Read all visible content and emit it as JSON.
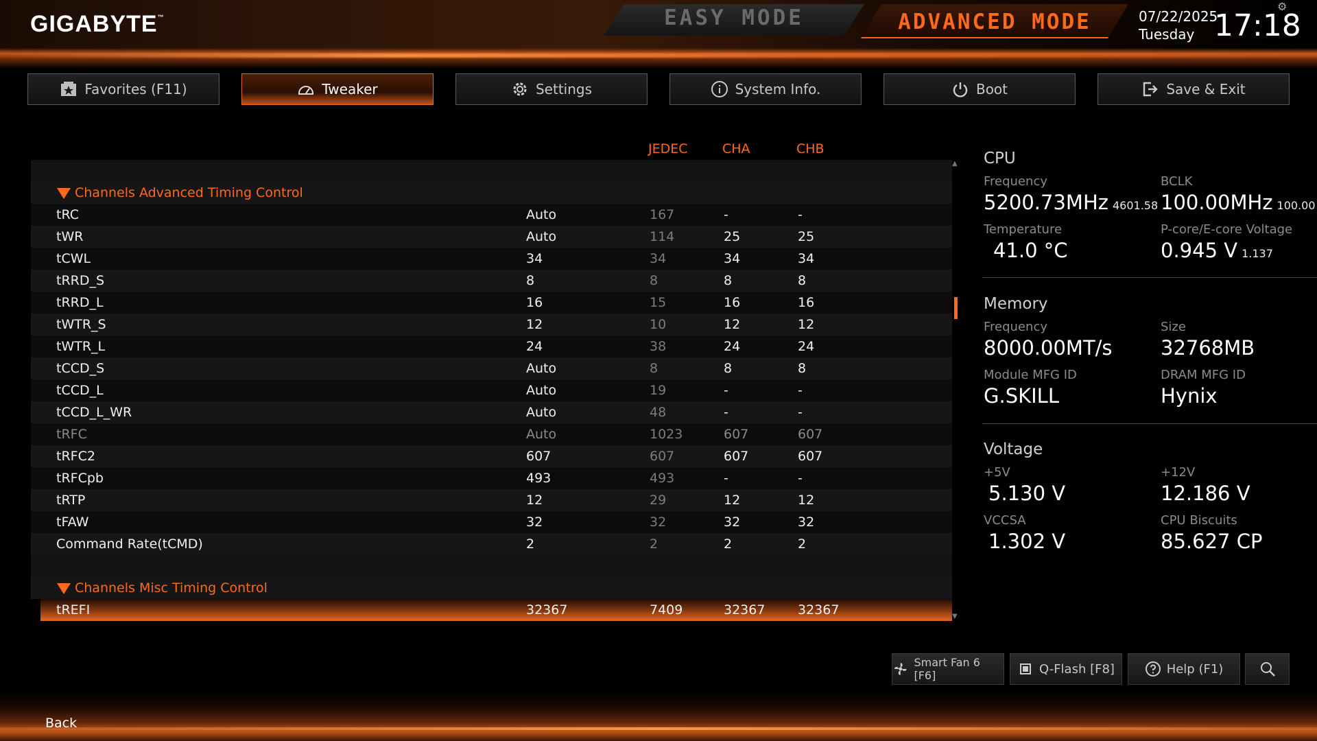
{
  "header": {
    "logo": "GIGABYTE",
    "logo_mark": "™",
    "easy_mode": "EASY MODE",
    "advanced_mode": "ADVANCED MODE",
    "date": "07/22/2025",
    "day": "Tuesday",
    "time": "17:18"
  },
  "tabs": [
    {
      "label": "Favorites (F11)",
      "icon": "star-icon"
    },
    {
      "label": "Tweaker",
      "icon": "speedometer-icon"
    },
    {
      "label": "Settings",
      "icon": "gear-icon"
    },
    {
      "label": "System Info.",
      "icon": "info-icon"
    },
    {
      "label": "Boot",
      "icon": "power-icon"
    },
    {
      "label": "Save & Exit",
      "icon": "exit-icon"
    }
  ],
  "active_tab": "Tweaker",
  "table": {
    "columns": [
      "JEDEC",
      "CHA",
      "CHB"
    ],
    "section1": "Channels Advanced Timing Control",
    "rows": [
      {
        "name": "tRC",
        "setting": "Auto",
        "jedec": "167",
        "cha": "-",
        "chb": "-"
      },
      {
        "name": "tWR",
        "setting": "Auto",
        "jedec": "114",
        "cha": "25",
        "chb": "25"
      },
      {
        "name": "tCWL",
        "setting": "34",
        "jedec": "34",
        "cha": "34",
        "chb": "34"
      },
      {
        "name": "tRRD_S",
        "setting": "8",
        "jedec": "8",
        "cha": "8",
        "chb": "8"
      },
      {
        "name": "tRRD_L",
        "setting": "16",
        "jedec": "15",
        "cha": "16",
        "chb": "16"
      },
      {
        "name": "tWTR_S",
        "setting": "12",
        "jedec": "10",
        "cha": "12",
        "chb": "12"
      },
      {
        "name": "tWTR_L",
        "setting": "24",
        "jedec": "38",
        "cha": "24",
        "chb": "24"
      },
      {
        "name": "tCCD_S",
        "setting": "Auto",
        "jedec": "8",
        "cha": "8",
        "chb": "8"
      },
      {
        "name": "tCCD_L",
        "setting": "Auto",
        "jedec": "19",
        "cha": "-",
        "chb": "-"
      },
      {
        "name": "tCCD_L_WR",
        "setting": "Auto",
        "jedec": "48",
        "cha": "-",
        "chb": "-"
      },
      {
        "name": "tRFC",
        "setting": "Auto",
        "jedec": "1023",
        "cha": "607",
        "chb": "607"
      },
      {
        "name": "tRFC2",
        "setting": "607",
        "jedec": "607",
        "cha": "607",
        "chb": "607"
      },
      {
        "name": "tRFCpb",
        "setting": "493",
        "jedec": "493",
        "cha": "-",
        "chb": "-"
      },
      {
        "name": "tRTP",
        "setting": "12",
        "jedec": "29",
        "cha": "12",
        "chb": "12"
      },
      {
        "name": "tFAW",
        "setting": "32",
        "jedec": "32",
        "cha": "32",
        "chb": "32"
      },
      {
        "name": "Command Rate(tCMD)",
        "setting": "2",
        "jedec": "2",
        "cha": "2",
        "chb": "2"
      }
    ],
    "section2": "Channels Misc Timing Control",
    "selected_row": {
      "name": "tREFI",
      "setting": "32367",
      "jedec": "7409",
      "cha": "32367",
      "chb": "32367"
    }
  },
  "cpu": {
    "title": "CPU",
    "freq_label": "Frequency",
    "freq": "5200.73MHz",
    "freq_sub": "4601.58",
    "bclk_label": "BCLK",
    "bclk": "100.00MHz",
    "bclk_sub": "100.00",
    "temp_label": "Temperature",
    "temp": "41.0 °C",
    "volt_label": "P-core/E-core Voltage",
    "volt": "0.945 V",
    "volt_sub": "1.137"
  },
  "memory": {
    "title": "Memory",
    "freq_label": "Frequency",
    "freq": "8000.00MT/s",
    "size_label": "Size",
    "size": "32768MB",
    "module_label": "Module MFG ID",
    "module": "G.SKILL",
    "dram_label": "DRAM MFG ID",
    "dram": "Hynix"
  },
  "voltage": {
    "title": "Voltage",
    "v5_label": "+5V",
    "v5": "5.130 V",
    "v12_label": "+12V",
    "v12": "12.186 V",
    "vccsa_label": "VCCSA",
    "vccsa": "1.302 V",
    "biscuits_label": "CPU Biscuits",
    "biscuits": "85.627 CP"
  },
  "bottom_buttons": {
    "smart_fan": "Smart Fan 6 [F6]",
    "qflash": "Q-Flash [F8]",
    "help": "Help (F1)"
  },
  "footer": {
    "back": "Back"
  },
  "colors": {
    "accent": "#ff6a1a",
    "background": "#000000",
    "muted": "#7c7c7c"
  }
}
